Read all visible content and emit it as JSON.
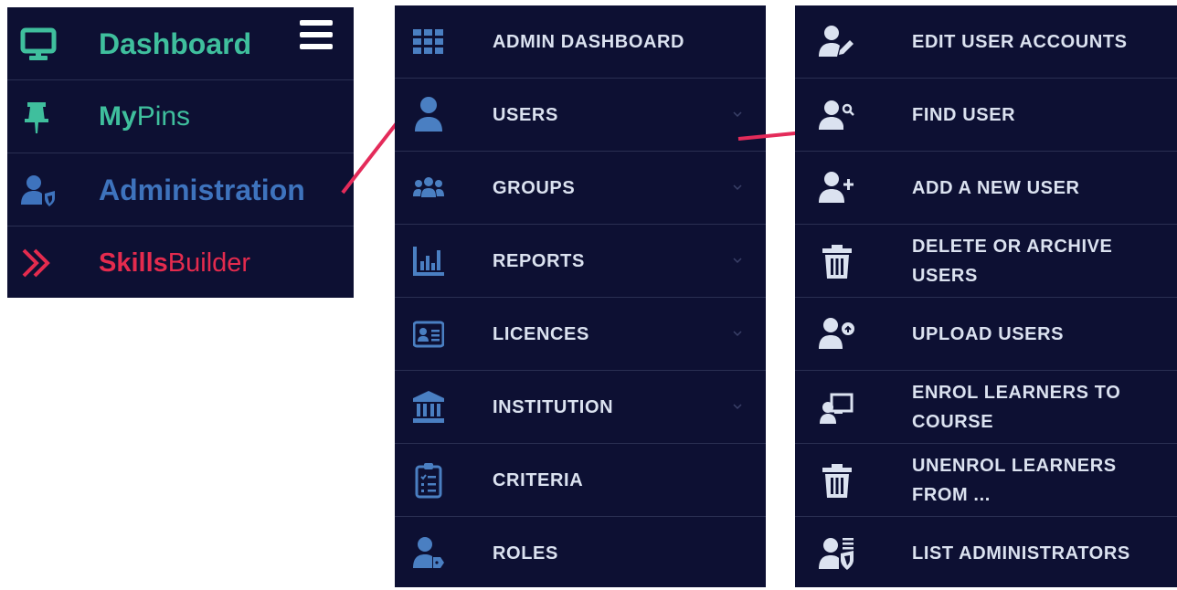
{
  "colors": {
    "panel_bg": "#0d1033",
    "divider": "#2a2f52",
    "teal": "#3fbf9d",
    "admin_blue": "#3e73bd",
    "skills_red": "#e42b4e",
    "menu_text": "#dbe2f0",
    "icon_blue": "#4a7fc2",
    "connector": "#e42b5a"
  },
  "main_menu": {
    "items": [
      {
        "label_parts": [
          "Dashboard",
          ""
        ],
        "icon": "monitor-icon"
      },
      {
        "label_parts": [
          "My",
          "Pins"
        ],
        "icon": "pin-icon"
      },
      {
        "label_parts": [
          "Administration",
          ""
        ],
        "icon": "user-shield-icon"
      },
      {
        "label_parts": [
          "Skills",
          "Builder"
        ],
        "icon": "double-chevron-right-icon"
      }
    ],
    "menu_icon": "hamburger-menu-icon"
  },
  "admin_menu": {
    "items": [
      {
        "label": "ADMIN DASHBOARD",
        "icon": "grid-icon",
        "has_submenu": false
      },
      {
        "label": "USERS",
        "icon": "user-icon",
        "has_submenu": true
      },
      {
        "label": "GROUPS",
        "icon": "users-group-icon",
        "has_submenu": true
      },
      {
        "label": "REPORTS",
        "icon": "bar-chart-icon",
        "has_submenu": true
      },
      {
        "label": "LICENCES",
        "icon": "id-card-icon",
        "has_submenu": true
      },
      {
        "label": "INSTITUTION",
        "icon": "bank-icon",
        "has_submenu": true
      },
      {
        "label": "CRITERIA",
        "icon": "clipboard-list-icon",
        "has_submenu": false
      },
      {
        "label": "ROLES",
        "icon": "user-tag-icon",
        "has_submenu": false
      }
    ]
  },
  "users_submenu": {
    "items": [
      {
        "lines": [
          "EDIT USER ACCOUNTS"
        ],
        "icon": "user-edit-icon"
      },
      {
        "lines": [
          "FIND USER"
        ],
        "icon": "user-search-icon"
      },
      {
        "lines": [
          "ADD A NEW USER"
        ],
        "icon": "user-plus-icon"
      },
      {
        "lines": [
          "DELETE OR ARCHIVE",
          "USERS"
        ],
        "icon": "trash-icon"
      },
      {
        "lines": [
          "UPLOAD USERS"
        ],
        "icon": "user-upload-icon"
      },
      {
        "lines": [
          "ENROL LEARNERS TO",
          "COURSE"
        ],
        "icon": "chalkboard-teacher-icon"
      },
      {
        "lines": [
          "UNENROL LEARNERS",
          "FROM ..."
        ],
        "icon": "trash-icon"
      },
      {
        "lines": [
          "LIST ADMINISTRATORS"
        ],
        "icon": "user-shield-list-icon"
      }
    ]
  }
}
